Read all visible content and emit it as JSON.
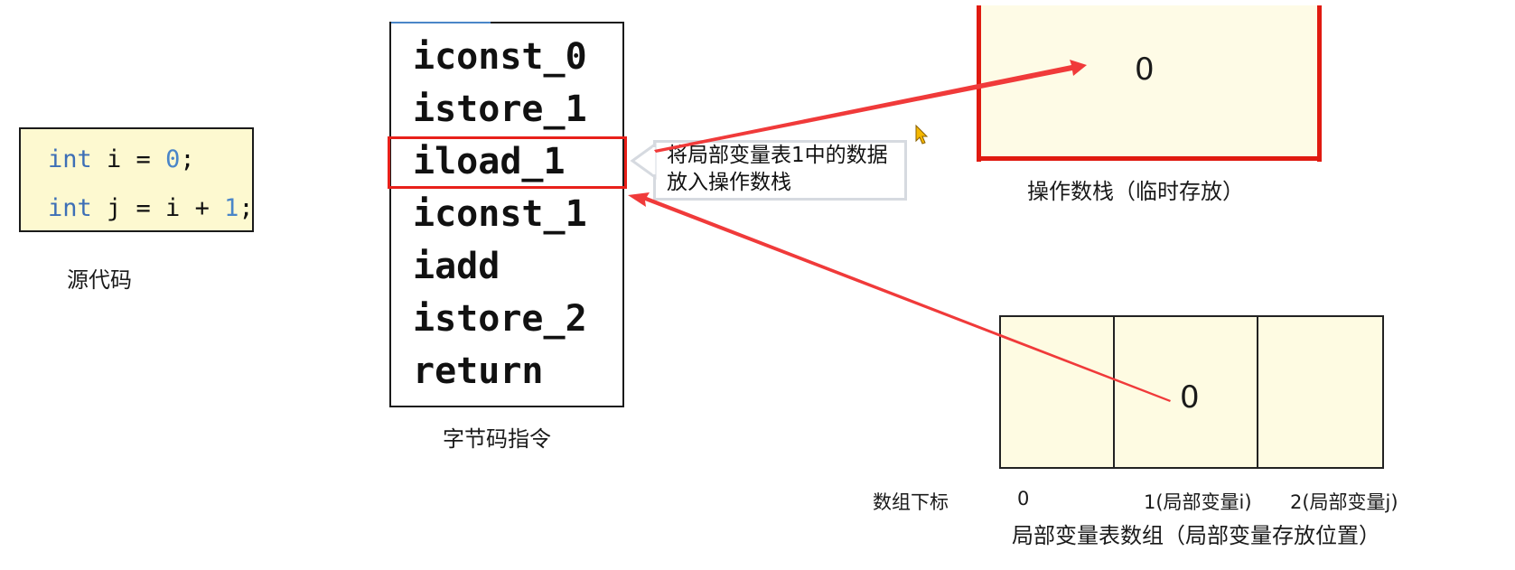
{
  "source_code": {
    "lines": [
      {
        "keyword": "int",
        "rest_before": " i = ",
        "number": "0",
        "rest_after": ";"
      },
      {
        "keyword": "int",
        "rest_before": " j = i + ",
        "number": "1",
        "rest_after": ";"
      }
    ],
    "caption": "源代码"
  },
  "bytecode": {
    "instructions": [
      "iconst_0",
      "istore_1",
      "iload_1",
      "iconst_1",
      "iadd",
      "istore_2",
      "return"
    ],
    "highlighted_index": 2,
    "caption": "字节码指令"
  },
  "callout": {
    "text": "将局部变量表1中的数据放入操作数栈"
  },
  "operand_stack": {
    "value": "0",
    "caption": "操作数栈（临时存放）"
  },
  "local_variable_table": {
    "cells": [
      "",
      "0",
      ""
    ],
    "index_title": "数组下标",
    "index_labels": [
      "0",
      "1(局部变量i)",
      "2(局部变量j)"
    ],
    "caption": "局部变量表数组（局部变量存放位置）"
  },
  "colors": {
    "highlight": "#e8201a",
    "arrow": "#f03a3a",
    "cell_fill": "#fefbe2",
    "code_keyword": "#3d6fb6"
  }
}
